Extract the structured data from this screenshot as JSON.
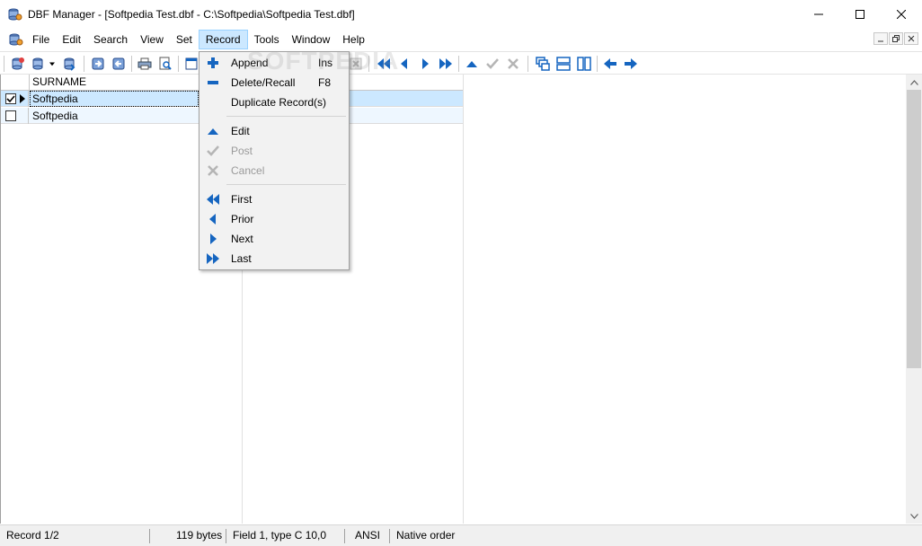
{
  "window": {
    "title": "DBF Manager - [Softpedia Test.dbf - C:\\Softpedia\\Softpedia Test.dbf]",
    "icon": "dbf-app-icon",
    "controls": [
      "minimize-icon",
      "maximize-icon",
      "close-icon"
    ]
  },
  "menubar": {
    "items": [
      {
        "label": "File"
      },
      {
        "label": "Edit"
      },
      {
        "label": "Search"
      },
      {
        "label": "View"
      },
      {
        "label": "Set"
      },
      {
        "label": "Record",
        "active": true
      },
      {
        "label": "Tools"
      },
      {
        "label": "Window"
      },
      {
        "label": "Help"
      }
    ]
  },
  "record_menu": {
    "items": [
      {
        "label": "Append",
        "shortcut": "Ins",
        "icon": "plus-icon",
        "enabled": true
      },
      {
        "label": "Delete/Recall",
        "shortcut": "F8",
        "icon": "minus-icon",
        "enabled": true
      },
      {
        "label": "Duplicate Record(s)",
        "shortcut": "",
        "icon": "",
        "enabled": true
      },
      {
        "label": "Edit",
        "shortcut": "",
        "icon": "triangle-up-icon",
        "enabled": true
      },
      {
        "label": "Post",
        "shortcut": "",
        "icon": "check-icon",
        "enabled": false
      },
      {
        "label": "Cancel",
        "shortcut": "",
        "icon": "cross-icon",
        "enabled": false
      },
      {
        "label": "First",
        "shortcut": "",
        "icon": "double-left-icon",
        "enabled": true
      },
      {
        "label": "Prior",
        "shortcut": "",
        "icon": "left-icon",
        "enabled": true
      },
      {
        "label": "Next",
        "shortcut": "",
        "icon": "right-icon",
        "enabled": true
      },
      {
        "label": "Last",
        "shortcut": "",
        "icon": "double-right-icon",
        "enabled": true
      }
    ]
  },
  "grid": {
    "columns": [
      "SURNAME"
    ],
    "rows": [
      {
        "checked": true,
        "current": true,
        "surname": "Softpedia"
      },
      {
        "checked": false,
        "current": false,
        "surname": "Softpedia"
      }
    ]
  },
  "statusbar": {
    "record": "Record 1/2",
    "size": "119 bytes",
    "field": "Field 1, type C 10,0",
    "encoding": "ANSI",
    "order": "Native order"
  },
  "watermark": "SOFTPEDIA",
  "colors": {
    "accent_blue": "#1565c0",
    "selection": "#cce8ff",
    "menu_bg": "#f2f2f2"
  }
}
